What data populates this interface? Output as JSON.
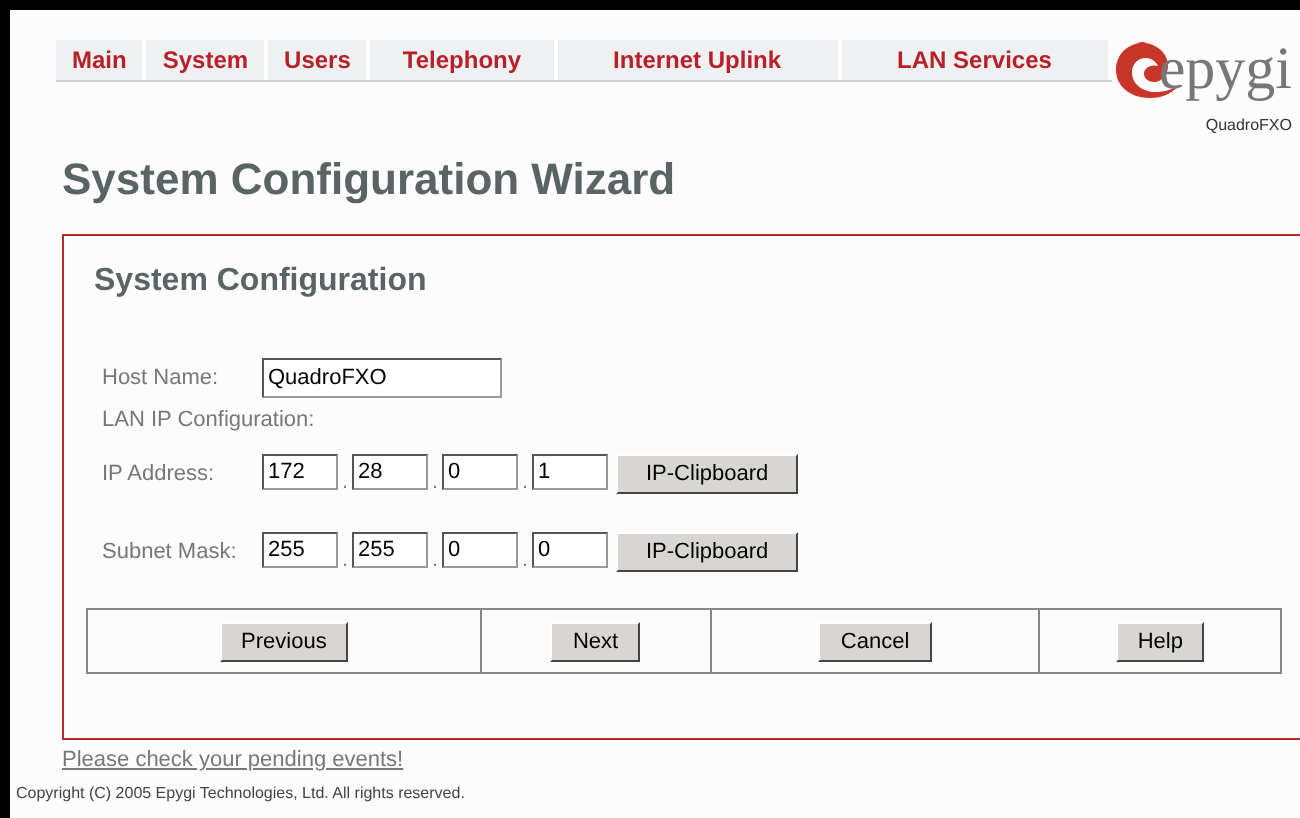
{
  "menu": [
    {
      "label": "Main"
    },
    {
      "label": "System"
    },
    {
      "label": "Users"
    },
    {
      "label": "Telephony"
    },
    {
      "label": "Internet Uplink"
    },
    {
      "label": "LAN Services"
    }
  ],
  "logo": {
    "brand": "epygi",
    "model": "QuadroFXO"
  },
  "page_title": "System Configuration Wizard",
  "panel": {
    "title": "System Configuration",
    "host_name": {
      "label": "Host Name:",
      "value": "QuadroFXO"
    },
    "section_label": "LAN IP Configuration:",
    "octet_separator": ".",
    "ip_rows": [
      {
        "label": "IP Address:",
        "octets": [
          "172",
          "28",
          "0",
          "1"
        ],
        "button": "IP-Clipboard"
      },
      {
        "label": "Subnet Mask:",
        "octets": [
          "255",
          "255",
          "0",
          "0"
        ],
        "button": "IP-Clipboard"
      }
    ],
    "buttons": [
      "Previous",
      "Next",
      "Cancel",
      "Help"
    ]
  },
  "pending_link": "Please check your pending events!",
  "copyright": "Copyright (C) 2005 Epygi Technologies, Ltd. All rights reserved."
}
